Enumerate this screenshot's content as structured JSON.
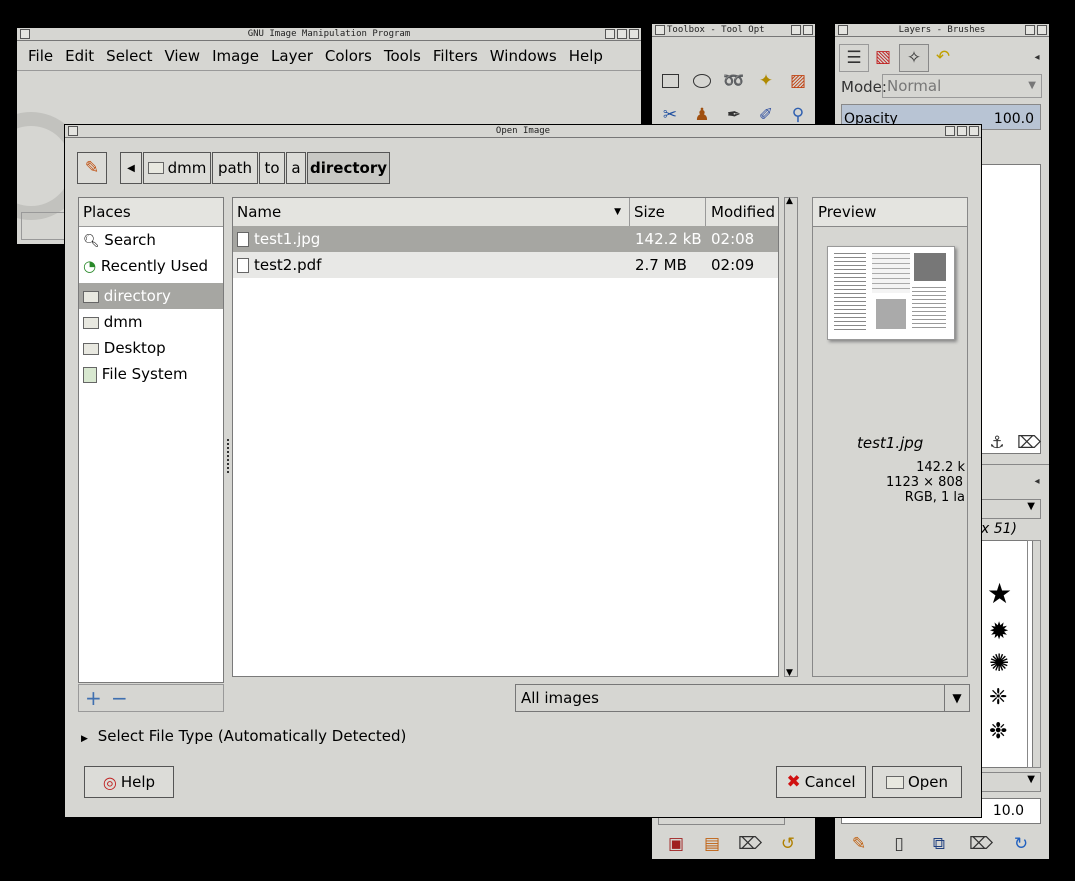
{
  "gimp_main": {
    "title": "GNU Image Manipulation Program",
    "menu": [
      "File",
      "Edit",
      "Select",
      "View",
      "Image",
      "Layer",
      "Colors",
      "Tools",
      "Filters",
      "Windows",
      "Help"
    ]
  },
  "toolbox": {
    "title": "Toolbox - Tool Opt"
  },
  "layers": {
    "title": "Layers - Brushes",
    "mode_label": "Mode:",
    "mode_value": "Normal",
    "opacity_label": "Opacity",
    "opacity_value": "100.0",
    "brush_size_partial": "x 51)",
    "spacing_value": "10.0"
  },
  "dialog": {
    "title": "Open Image",
    "path": [
      "dmm",
      "path",
      "to",
      "a",
      "directory"
    ],
    "places_header": "Places",
    "places": [
      {
        "label": "Search",
        "icon": "search-icon"
      },
      {
        "label": "Recently Used",
        "icon": "recent-icon"
      },
      {
        "label": "directory",
        "icon": "folder-icon",
        "selected": true
      },
      {
        "label": "dmm",
        "icon": "folder-icon"
      },
      {
        "label": "Desktop",
        "icon": "folder-icon"
      },
      {
        "label": "File System",
        "icon": "drive-icon"
      }
    ],
    "columns": {
      "name": "Name",
      "size": "Size",
      "modified": "Modified"
    },
    "files": [
      {
        "name": "test1.jpg",
        "size": "142.2 kB",
        "modified": "02:08",
        "selected": true
      },
      {
        "name": "test2.pdf",
        "size": "2.7 MB",
        "modified": "02:09",
        "selected": false
      }
    ],
    "preview": {
      "header": "Preview",
      "filename": "test1.jpg",
      "size": "142.2 k",
      "dims": "1123 × 808",
      "info": "RGB, 1 la"
    },
    "filter_value": "All images",
    "select_file_type": "Select File Type (Automatically Detected)",
    "help_label": "Help",
    "cancel_label": "Cancel",
    "open_label": "Open"
  }
}
